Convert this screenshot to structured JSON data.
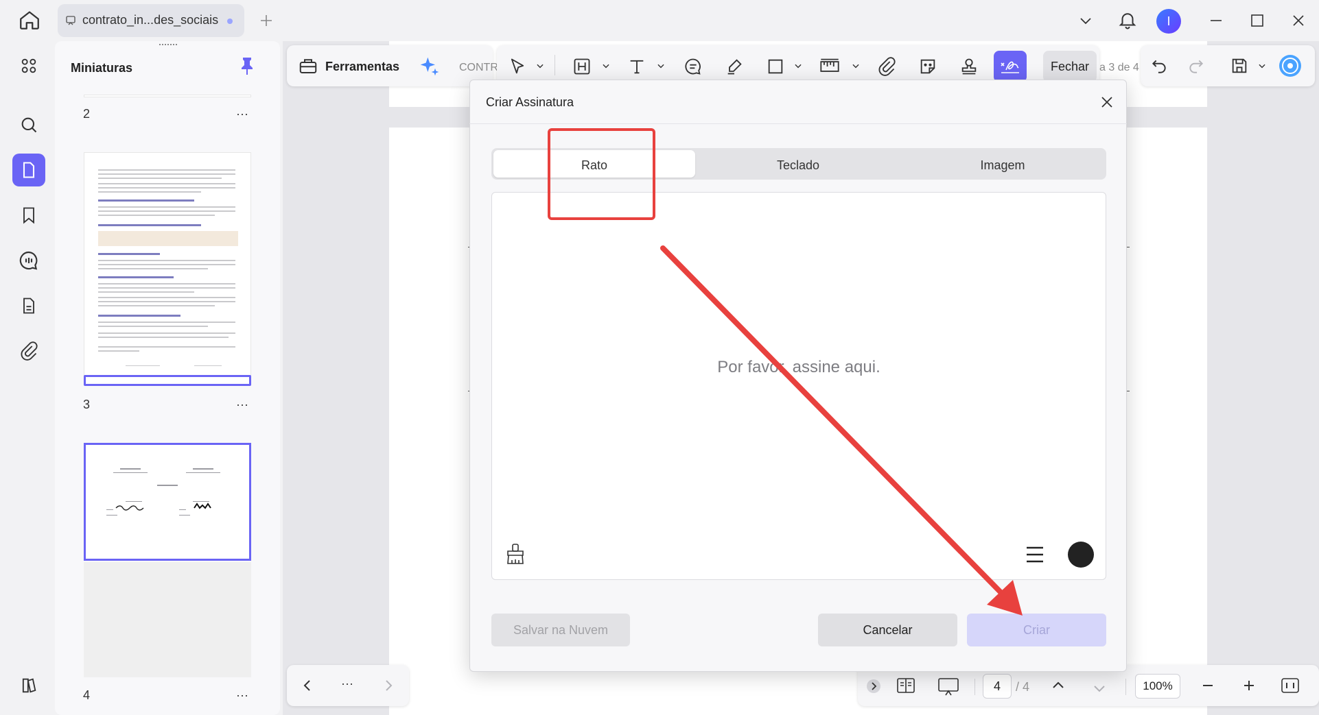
{
  "window": {
    "tab_title": "contrato_in...des_sociais",
    "avatar_letter": "I"
  },
  "thumbnails": {
    "title": "Miniaturas",
    "pages": [
      {
        "number": "2"
      },
      {
        "number": "3"
      },
      {
        "number": "4"
      }
    ],
    "more_label": "···"
  },
  "toolbar": {
    "tools_label": "Ferramentas",
    "doc_name_partial": "CONTR",
    "page_indicator_partial": "a 3 de 4",
    "close_label": "Fechar"
  },
  "dialog": {
    "title": "Criar Assinatura",
    "tabs": [
      {
        "label": "Rato",
        "active": true
      },
      {
        "label": "Teclado",
        "active": false
      },
      {
        "label": "Imagem",
        "active": false
      }
    ],
    "placeholder": "Por favor, assine aqui.",
    "buttons": {
      "save_cloud": "Salvar na Nuvem",
      "cancel": "Cancelar",
      "create": "Criar"
    },
    "ink_color": "#222222"
  },
  "pagination": {
    "current_page": "4",
    "total_pages": "/ 4",
    "zoom": "100%",
    "more": "···"
  },
  "colors": {
    "accent": "#6a64f5",
    "annotation_red": "#e8413e"
  }
}
